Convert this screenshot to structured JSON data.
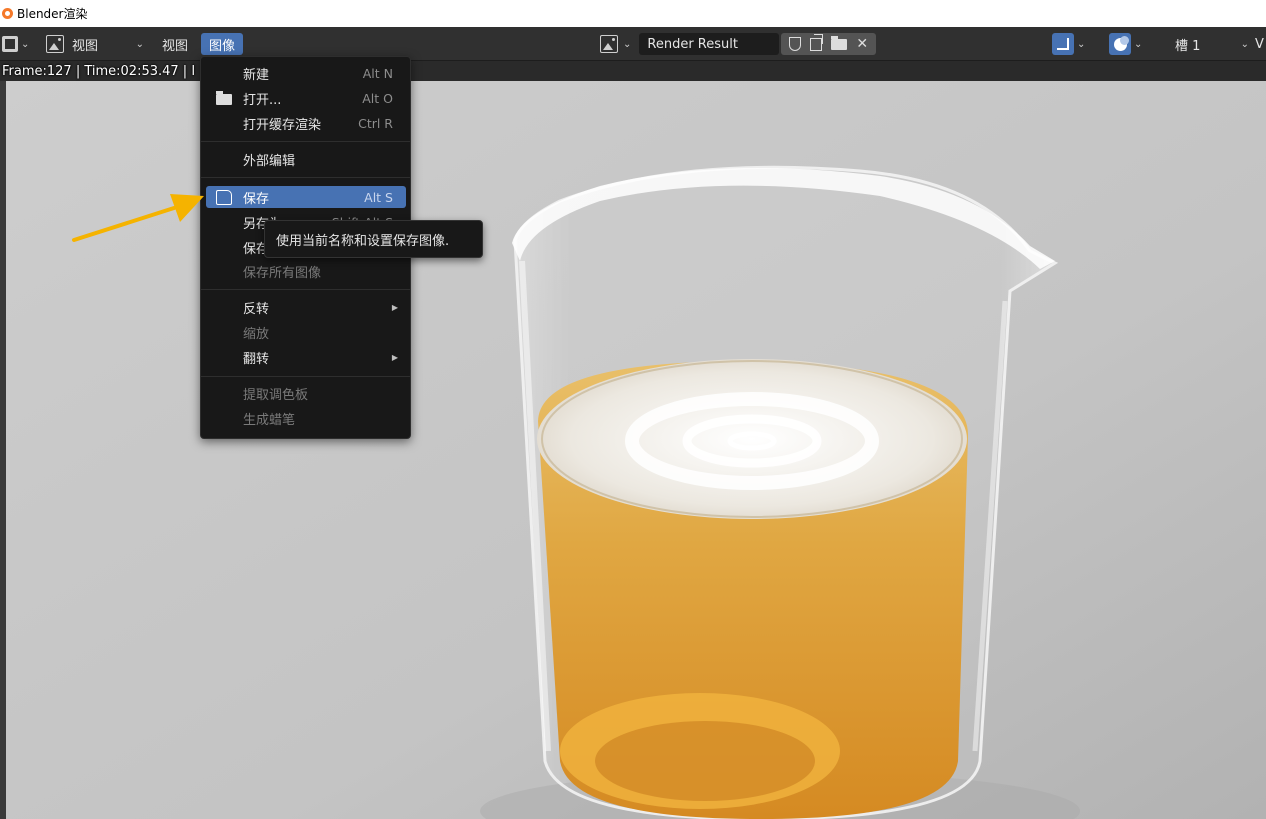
{
  "window": {
    "title": "Blender渲染"
  },
  "header": {
    "view_dropdown_label": "视图",
    "menu_view": "视图",
    "menu_image": "图像",
    "image_name": "Render Result",
    "slot_label": "槽 1",
    "view_layer_abbrev": "V"
  },
  "render_info": "Frame:127 | Time:02:53.47 | I",
  "image_menu": {
    "items": [
      {
        "label": "新建",
        "shortcut": "Alt N"
      },
      {
        "label": "打开...",
        "shortcut": "Alt O",
        "icon": "folder-icon"
      },
      {
        "label": "打开缓存渲染",
        "shortcut": "Ctrl R"
      },
      {
        "label": "外部编辑",
        "shortcut": ""
      },
      {
        "label": "保存",
        "shortcut": "Alt S",
        "icon": "save-icon",
        "highlighted": true
      },
      {
        "label": "另存为",
        "shortcut": "Shift Alt S"
      },
      {
        "label": "保存副本",
        "shortcut": ""
      },
      {
        "label": "保存所有图像",
        "shortcut": "",
        "disabled": true
      },
      {
        "label": "反转",
        "shortcut": "",
        "submenu": true
      },
      {
        "label": "缩放",
        "shortcut": "",
        "disabled": true
      },
      {
        "label": "翻转",
        "shortcut": "",
        "submenu": true
      },
      {
        "label": "提取调色板",
        "shortcut": "",
        "disabled": true
      },
      {
        "label": "生成蜡笔",
        "shortcut": "",
        "disabled": true
      }
    ]
  },
  "tooltip": {
    "text": "使用当前名称和设置保存图像."
  },
  "colors": {
    "accent": "#4772b3",
    "header_bg": "#303030",
    "menu_bg": "#181818",
    "annotation_arrow": "#f5b300",
    "liquid": "#e2a43c"
  }
}
